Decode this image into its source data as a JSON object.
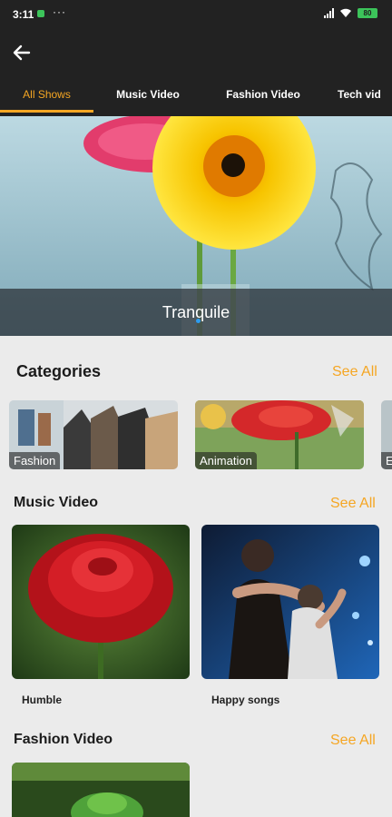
{
  "status_bar": {
    "time": "3:11",
    "more": "···",
    "battery": "80"
  },
  "tabs": [
    {
      "label": "All Shows",
      "active": true
    },
    {
      "label": "Music Video",
      "active": false
    },
    {
      "label": "Fashion Video",
      "active": false
    },
    {
      "label": "Tech vid",
      "active": false
    }
  ],
  "hero": {
    "caption": "Tranquile"
  },
  "categories": {
    "title": "Categories",
    "see_all": "See All",
    "items": [
      {
        "label": "Fashion"
      },
      {
        "label": "Animation"
      },
      {
        "label": "E"
      }
    ]
  },
  "music_video": {
    "title": "Music Video",
    "see_all": "See All",
    "items": [
      {
        "label": "Humble"
      },
      {
        "label": "Happy songs"
      }
    ]
  },
  "fashion_video": {
    "title": "Fashion Video",
    "see_all": "See All"
  },
  "colors": {
    "accent": "#f5a623",
    "bar": "#222222",
    "background": "#ebebeb"
  }
}
